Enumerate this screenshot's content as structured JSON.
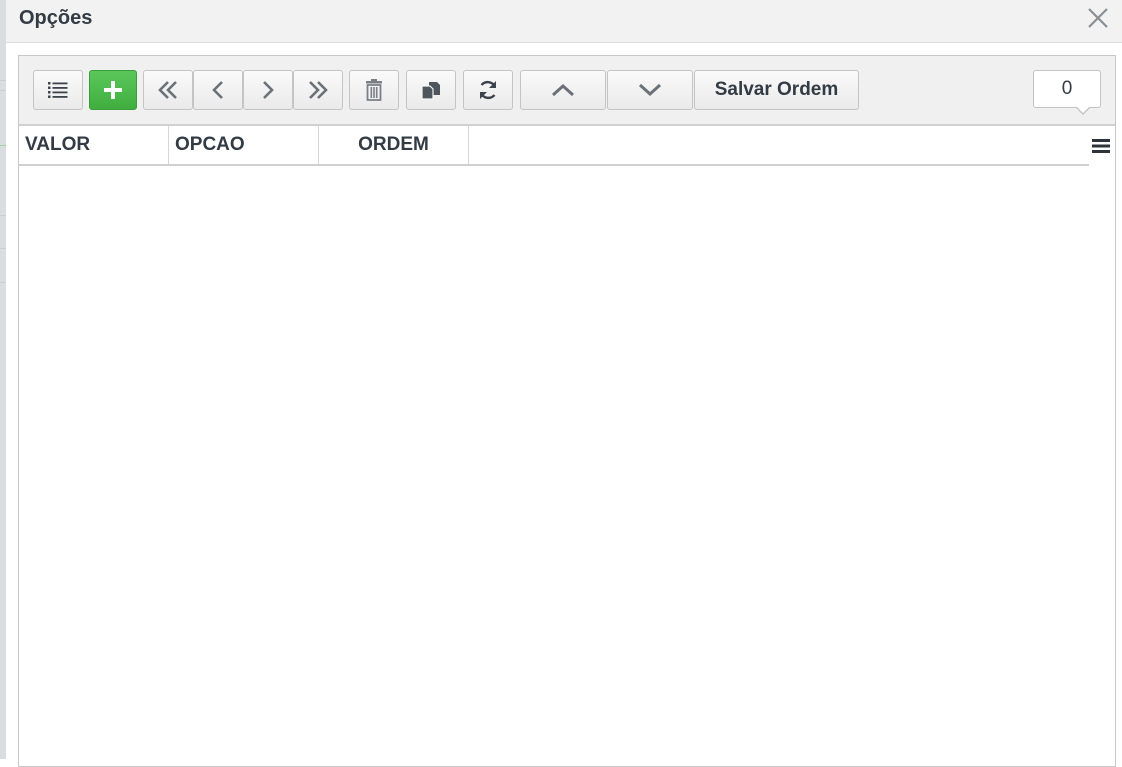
{
  "dialog": {
    "title": "Opções"
  },
  "toolbar": {
    "buttons": [
      {
        "icon": "list-icon"
      },
      {
        "icon": "plus-icon"
      },
      {
        "icon": "first-page-icon"
      },
      {
        "icon": "previous-icon"
      },
      {
        "icon": "next-icon"
      },
      {
        "icon": "last-page-icon"
      },
      {
        "icon": "trash-icon"
      },
      {
        "icon": "copy-icon"
      },
      {
        "icon": "refresh-icon"
      },
      {
        "icon": "move-up-icon"
      },
      {
        "icon": "move-down-icon"
      }
    ],
    "save_order_label": "Salvar Ordem",
    "record_count": "0"
  },
  "grid": {
    "columns": [
      "VALOR",
      "OPCAO",
      "ORDEM"
    ],
    "rows": []
  },
  "colors": {
    "add_button": "#47b847",
    "text": "#333b45",
    "icon": "#555b63"
  }
}
